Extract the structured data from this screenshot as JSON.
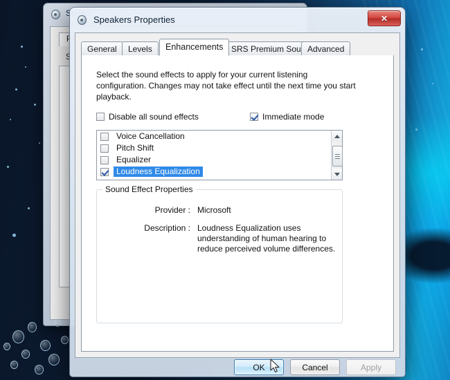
{
  "desktop": {
    "wallpaper_name": "underwater-bubbles-wallpaper",
    "colors": {
      "deep": "#0a1628",
      "mid": "#103a63",
      "bright": "#12a8dd"
    }
  },
  "background_window": {
    "title": "Sound",
    "icon": "speaker-icon",
    "tab_label": "Playback",
    "sub_label": "S",
    "button_label": ""
  },
  "dialog": {
    "title": "Speakers Properties",
    "icon": "speaker-icon",
    "close_label": "✕",
    "tabs": [
      {
        "label": "General",
        "active": false
      },
      {
        "label": "Levels",
        "active": false
      },
      {
        "label": "Enhancements",
        "active": true
      },
      {
        "label": "SRS Premium Sound",
        "active": false
      },
      {
        "label": "Advanced",
        "active": false
      }
    ],
    "intro_text": "Select the sound effects to apply for your current listening configuration. Changes may not take effect until the next time you start playback.",
    "checkboxes": [
      {
        "label": "Disable all sound effects",
        "checked": false
      },
      {
        "label": "Immediate mode",
        "checked": true
      }
    ],
    "effects": [
      {
        "label": "Voice Cancellation",
        "checked": false,
        "selected": false
      },
      {
        "label": "Pitch Shift",
        "checked": false,
        "selected": false
      },
      {
        "label": "Equalizer",
        "checked": false,
        "selected": false
      },
      {
        "label": "Loudness Equalization",
        "checked": true,
        "selected": true
      }
    ],
    "group": {
      "title": "Sound Effect Properties",
      "provider_label": "Provider :",
      "provider_value": "Microsoft",
      "description_label": "Description :",
      "description_value": "Loudness Equalization uses understanding of human hearing to reduce perceived volume differences."
    },
    "buttons": [
      {
        "label": "OK",
        "state": "hovered"
      },
      {
        "label": "Cancel",
        "state": "normal"
      },
      {
        "label": "Apply",
        "state": "disabled"
      }
    ],
    "selection_color": "#2f8ae8"
  }
}
